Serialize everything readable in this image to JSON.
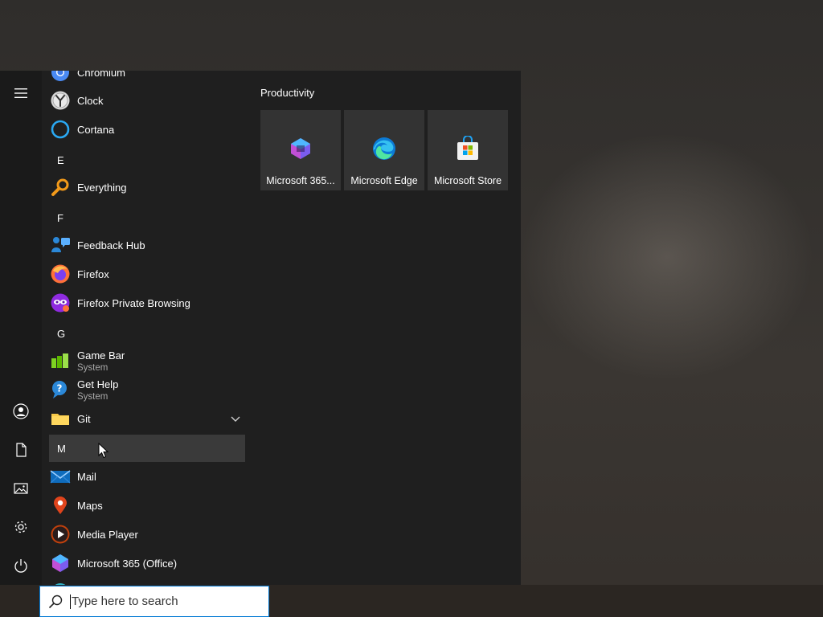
{
  "start_menu": {
    "rail": {
      "menu_icon": "hamburger-icon",
      "account_icon": "person-icon",
      "documents_icon": "document-icon",
      "pictures_icon": "pictures-icon",
      "settings_icon": "gear-icon",
      "power_icon": "power-icon"
    },
    "apps": {
      "chromium": "Chromium",
      "clock": "Clock",
      "cortana": "Cortana",
      "letter_e": "E",
      "everything": "Everything",
      "letter_f": "F",
      "feedback_hub": "Feedback Hub",
      "firefox": "Firefox",
      "firefox_private": "Firefox Private Browsing",
      "letter_g": "G",
      "game_bar": "Game Bar",
      "game_bar_sub": "System",
      "get_help": "Get Help",
      "get_help_sub": "System",
      "git": "Git",
      "letter_m": "M",
      "mail": "Mail",
      "maps": "Maps",
      "media_player": "Media Player",
      "m365": "Microsoft 365 (Office)"
    },
    "tiles": {
      "group_title": "Productivity",
      "items": [
        {
          "label": "Microsoft 365..."
        },
        {
          "label": "Microsoft Edge"
        },
        {
          "label": "Microsoft Store"
        }
      ]
    }
  },
  "taskbar": {
    "search_placeholder": "Type here to search",
    "search_icon": "search-icon"
  },
  "colors": {
    "menu_bg": "#1f1f1f",
    "rail_bg": "#1a1a1a",
    "tile_bg": "#333333",
    "hover_bg": "#3a3a3a",
    "accent": "#0078d4"
  }
}
